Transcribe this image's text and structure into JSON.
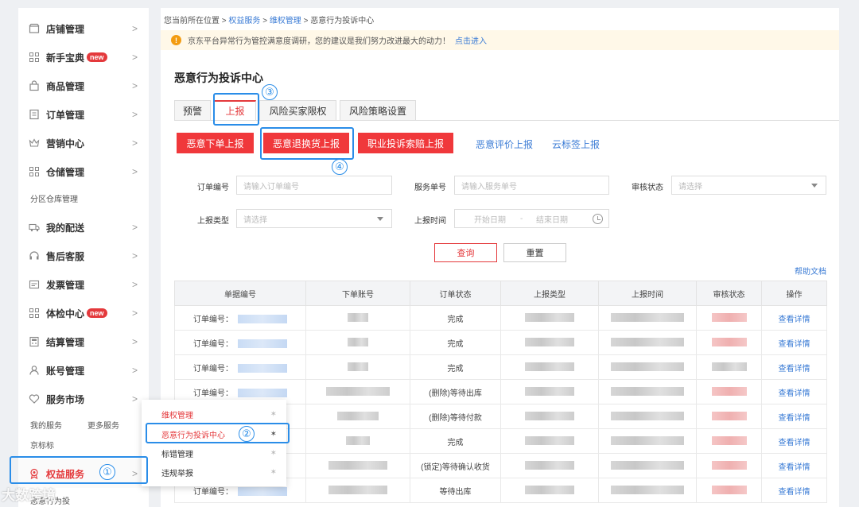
{
  "sidebar": {
    "items": [
      {
        "label": "店铺管理",
        "icon": "shop-icon"
      },
      {
        "label": "新手宝典",
        "icon": "grid-icon",
        "badge": "new"
      },
      {
        "label": "商品管理",
        "icon": "bag-icon"
      },
      {
        "label": "订单管理",
        "icon": "list-icon"
      },
      {
        "label": "营销中心",
        "icon": "crown-icon"
      },
      {
        "label": "仓储管理",
        "icon": "grid-icon"
      },
      {
        "label": "我的配送",
        "icon": "truck-icon"
      },
      {
        "label": "售后客服",
        "icon": "headset-icon"
      },
      {
        "label": "发票管理",
        "icon": "invoice-icon"
      },
      {
        "label": "体检中心",
        "icon": "grid-icon",
        "badge": "new"
      },
      {
        "label": "结算管理",
        "icon": "calculator-icon"
      },
      {
        "label": "账号管理",
        "icon": "user-icon"
      },
      {
        "label": "服务市场",
        "icon": "heart-icon"
      },
      {
        "label": "权益服务",
        "icon": "medal-icon"
      }
    ],
    "sub_warehouse": "分区仓库管理",
    "sub_my_service": "我的服务",
    "sub_more_service": "更多服务",
    "sub_jd_label": "京标标",
    "sub_malicious": "恶意行为投"
  },
  "breadcrumb": {
    "prefix": "您当前所在位置 >",
    "level1": "权益服务",
    "sep1": ">",
    "level2": "维权管理",
    "sep2": ">",
    "level3": "恶意行为投诉中心"
  },
  "notice": {
    "icon": "!",
    "text": "京东平台异常行为管控满意度调研，您的建议是我们努力改进最大的动力！",
    "link": "点击进入"
  },
  "page_title": "恶意行为投诉中心",
  "tabs": [
    "预警",
    "上报",
    "风险买家限权",
    "风险策略设置"
  ],
  "actions": {
    "buttons": [
      "恶意下单上报",
      "恶意退换货上报",
      "职业投诉索赔上报"
    ],
    "links": [
      "恶意评价上报",
      "云标签上报"
    ]
  },
  "filters": {
    "order_no_label": "订单编号",
    "order_no_placeholder": "请输入订单编号",
    "service_no_label": "服务单号",
    "service_no_placeholder": "请输入服务单号",
    "review_status_label": "审核状态",
    "review_status_placeholder": "请选择",
    "report_type_label": "上报类型",
    "report_type_placeholder": "请选择",
    "report_time_label": "上报时间",
    "start_date": "开始日期",
    "date_sep": "-",
    "end_date": "结束日期"
  },
  "query_button": "查询",
  "reset_button": "重置",
  "help_link": "帮助文档",
  "table": {
    "columns": [
      "单据编号",
      "下单账号",
      "订单状态",
      "上报类型",
      "上报时间",
      "审核状态",
      "操作"
    ],
    "rows": [
      {
        "prefix": "订单编号：",
        "status": "完成",
        "action": "查看详情"
      },
      {
        "prefix": "订单编号：",
        "status": "完成",
        "action": "查看详情"
      },
      {
        "prefix": "订单编号：",
        "status": "完成",
        "action": "查看详情"
      },
      {
        "prefix": "订单编号：",
        "status": "(删除)等待出库",
        "action": "查看详情"
      },
      {
        "prefix": "",
        "status": "(删除)等待付款",
        "action": "查看详情"
      },
      {
        "prefix": "",
        "status": "完成",
        "action": "查看详情"
      },
      {
        "prefix": "",
        "status": "(锁定)等待确认收货",
        "action": "查看详情"
      },
      {
        "prefix": "订单编号：",
        "status": "等待出库",
        "action": "查看详情"
      }
    ]
  },
  "popover": {
    "items": [
      {
        "label": "维权管理",
        "red": true
      },
      {
        "label": "恶意行为投诉中心",
        "red": true
      },
      {
        "label": "标错管理",
        "red": false
      },
      {
        "label": "违规举报",
        "red": false
      }
    ]
  },
  "annotations": [
    "①",
    "②",
    "③",
    "④"
  ],
  "watermark": "大数跨境",
  "colors": {
    "accent_red": "#e4393c",
    "link_blue": "#3a7bd5",
    "highlight_blue": "#2a8de8",
    "notice_bg": "#fff8e8"
  }
}
